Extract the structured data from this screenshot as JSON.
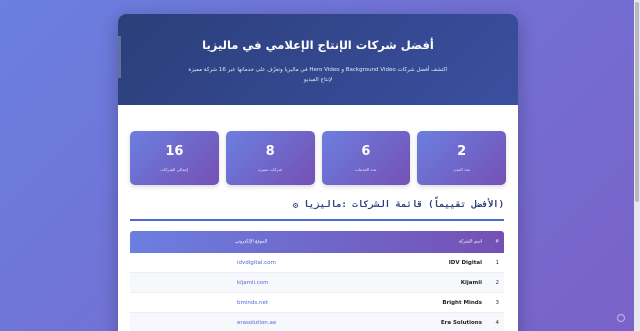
{
  "hero": {
    "title": "أفضل شركات الإنتاج الإعلامي في ماليزيا",
    "subtitle": "اكتشف أفضل شركات Background Video و Hero Video في ماليزيا وتعرّف على خدماتها عبر 16 شركة مميزة لإنتاج الفيديو"
  },
  "stats": [
    {
      "num": "2",
      "label": "عدد المدن"
    },
    {
      "num": "6",
      "label": "عدد الخدمات"
    },
    {
      "num": "8",
      "label": "شركات مميزة"
    },
    {
      "num": "16",
      "label": "إجمالي الشركات"
    }
  ],
  "section": {
    "title": "(الأفضل تقييماً) قائمة الشركات :ماليزيا ۞"
  },
  "table": {
    "headers": {
      "num": "#",
      "name": "اسم الشركة",
      "url": "الموقع الإلكتروني"
    },
    "rows": [
      {
        "num": "1",
        "name": "IDV Digital",
        "url": "idvdigital.com"
      },
      {
        "num": "2",
        "name": "Kijamii",
        "url": "kijamii.com"
      },
      {
        "num": "3",
        "name": "Bright Minds",
        "url": "bminds.net"
      },
      {
        "num": "4",
        "name": "Era Solutions",
        "url": "erasolution.ae"
      }
    ]
  },
  "watermark": {
    "text": ""
  }
}
